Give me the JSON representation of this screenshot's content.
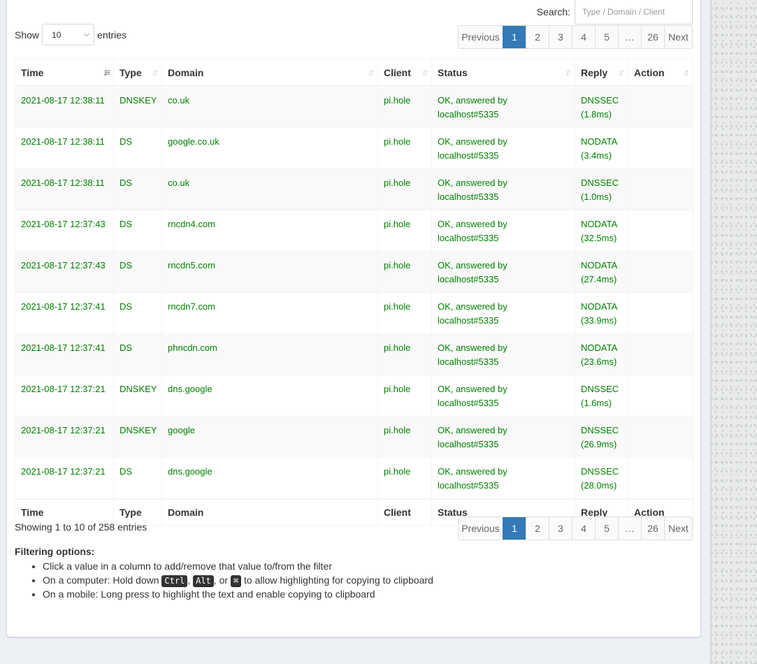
{
  "search": {
    "label": "Search:",
    "placeholder": "Type / Domain / Client"
  },
  "length": {
    "show_label": "Show",
    "value": "10",
    "entries_label": "entries"
  },
  "pagination": {
    "prev": "Previous",
    "next": "Next",
    "pages": [
      "1",
      "2",
      "3",
      "4",
      "5",
      "…",
      "26"
    ],
    "active_page": "1"
  },
  "table": {
    "headers": [
      "Time",
      "Type",
      "Domain",
      "Client",
      "Status",
      "Reply",
      "Action"
    ],
    "rows": [
      {
        "time": "2021-08-17 12:38:11",
        "type": "DNSKEY",
        "domain": "co.uk",
        "client": "pi.hole",
        "status": "OK, answered by localhost#5335",
        "reply": "DNSSEC",
        "reply_time": "(1.8ms)"
      },
      {
        "time": "2021-08-17 12:38:11",
        "type": "DS",
        "domain": "google.co.uk",
        "client": "pi.hole",
        "status": "OK, answered by localhost#5335",
        "reply": "NODATA",
        "reply_time": "(3.4ms)"
      },
      {
        "time": "2021-08-17 12:38:11",
        "type": "DS",
        "domain": "co.uk",
        "client": "pi.hole",
        "status": "OK, answered by localhost#5335",
        "reply": "DNSSEC",
        "reply_time": "(1.0ms)"
      },
      {
        "time": "2021-08-17 12:37:43",
        "type": "DS",
        "domain": "rncdn4.com",
        "client": "pi.hole",
        "status": "OK, answered by localhost#5335",
        "reply": "NODATA",
        "reply_time": "(32.5ms)"
      },
      {
        "time": "2021-08-17 12:37:43",
        "type": "DS",
        "domain": "rncdn5.com",
        "client": "pi.hole",
        "status": "OK, answered by localhost#5335",
        "reply": "NODATA",
        "reply_time": "(27.4ms)"
      },
      {
        "time": "2021-08-17 12:37:41",
        "type": "DS",
        "domain": "rncdn7.com",
        "client": "pi.hole",
        "status": "OK, answered by localhost#5335",
        "reply": "NODATA",
        "reply_time": "(33.9ms)"
      },
      {
        "time": "2021-08-17 12:37:41",
        "type": "DS",
        "domain": "phncdn.com",
        "client": "pi.hole",
        "status": "OK, answered by localhost#5335",
        "reply": "NODATA",
        "reply_time": "(23.6ms)"
      },
      {
        "time": "2021-08-17 12:37:21",
        "type": "DNSKEY",
        "domain": "dns.google",
        "client": "pi.hole",
        "status": "OK, answered by localhost#5335",
        "reply": "DNSSEC",
        "reply_time": "(1.6ms)"
      },
      {
        "time": "2021-08-17 12:37:21",
        "type": "DNSKEY",
        "domain": "google",
        "client": "pi.hole",
        "status": "OK, answered by localhost#5335",
        "reply": "DNSSEC",
        "reply_time": "(26.9ms)"
      },
      {
        "time": "2021-08-17 12:37:21",
        "type": "DS",
        "domain": "dns.google",
        "client": "pi.hole",
        "status": "OK, answered by localhost#5335",
        "reply": "DNSSEC",
        "reply_time": "(28.0ms)"
      }
    ]
  },
  "info": "Showing 1 to 10 of 258 entries",
  "filtering": {
    "title": "Filtering options:",
    "item1": "Click a value in a column to add/remove that value to/from the filter",
    "item2_prefix": "On a computer: Hold down",
    "key_ctrl": "Ctrl",
    "sep_comma": ",",
    "key_alt": "Alt",
    "sep_or": ", or",
    "key_cmd": "⌘",
    "item2_suffix": "to allow highlighting for copying to clipboard",
    "item3": "On a mobile: Long press to highlight the text and enable copying to clipboard"
  },
  "colors": {
    "accent": "#337ab7",
    "ok_text": "#008000"
  },
  "icons": {
    "sort": "sort-arrows-icon",
    "sort_active": "sort-descending-icon",
    "dropdown": "chevron-down-icon"
  }
}
